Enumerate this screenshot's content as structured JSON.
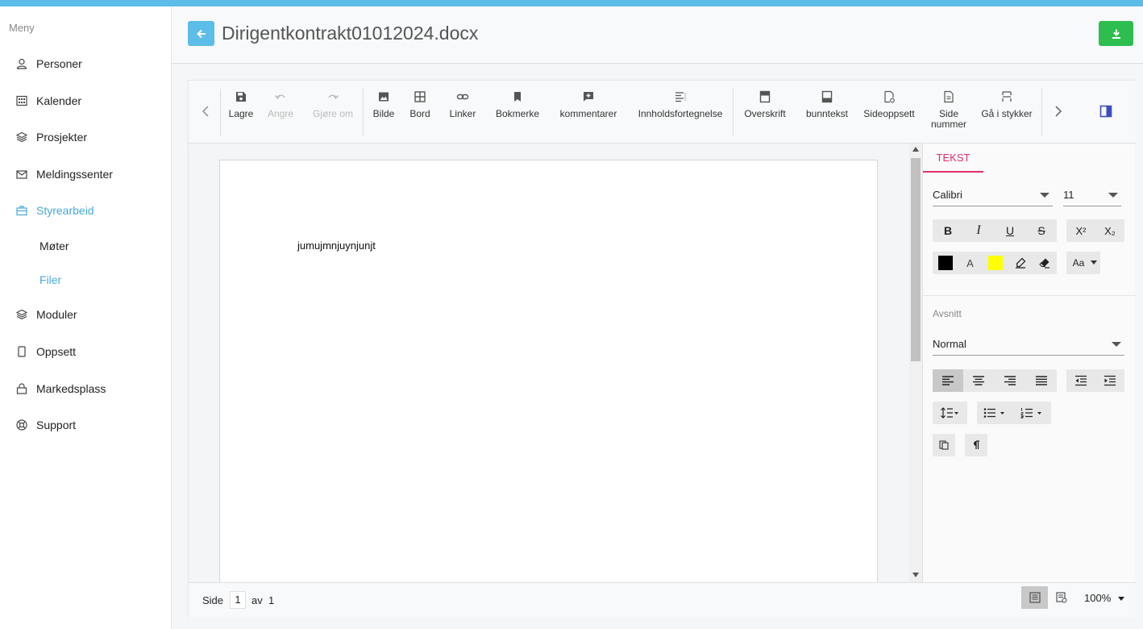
{
  "sidebar": {
    "menu_title": "Meny",
    "items": [
      {
        "label": "Personer"
      },
      {
        "label": "Kalender"
      },
      {
        "label": "Prosjekter"
      },
      {
        "label": "Meldingssenter"
      },
      {
        "label": "Styrearbeid"
      },
      {
        "label": "Moduler"
      },
      {
        "label": "Oppsett"
      },
      {
        "label": "Markedsplass"
      },
      {
        "label": "Support"
      }
    ],
    "subitems": [
      {
        "label": "Møter"
      },
      {
        "label": "Filer"
      }
    ],
    "accent_color": "#4aa8d8"
  },
  "header": {
    "title": "Dirigentkontrakt01012024.docx"
  },
  "toolbar": {
    "save": "Lagre",
    "undo": "Angre",
    "redo": "Gjøre om",
    "image": "Bilde",
    "table": "Bord",
    "link": "Linker",
    "bookmark": "Bokmerke",
    "comments": "kommentarer",
    "toc": "Innholdsfortegnelse",
    "header": "Overskrift",
    "footer": "bunntekst",
    "page_setup": "Sideoppsett",
    "page_number_line1": "Side",
    "page_number_line2": "nummer",
    "break": "Gå i stykker"
  },
  "document": {
    "text": "jumujmnjuynjunjt"
  },
  "properties": {
    "tab_label": "TEKST",
    "font_family": "Calibri",
    "font_size": "11",
    "bold": "B",
    "italic": "I",
    "underline": "U",
    "strikethrough": "S",
    "superscript": "X²",
    "subscript": "X₂",
    "font_color_label": "A",
    "case_label": "Aa",
    "paragraph_section": "Avsnitt",
    "paragraph_style": "Normal",
    "font_color": "#000000",
    "highlight_color": "#ffff00",
    "tab_accent": "#e02f6f"
  },
  "statusbar": {
    "page_label": "Side",
    "current_page": "1",
    "of_label": "av",
    "total_pages": "1",
    "zoom": "100%"
  }
}
